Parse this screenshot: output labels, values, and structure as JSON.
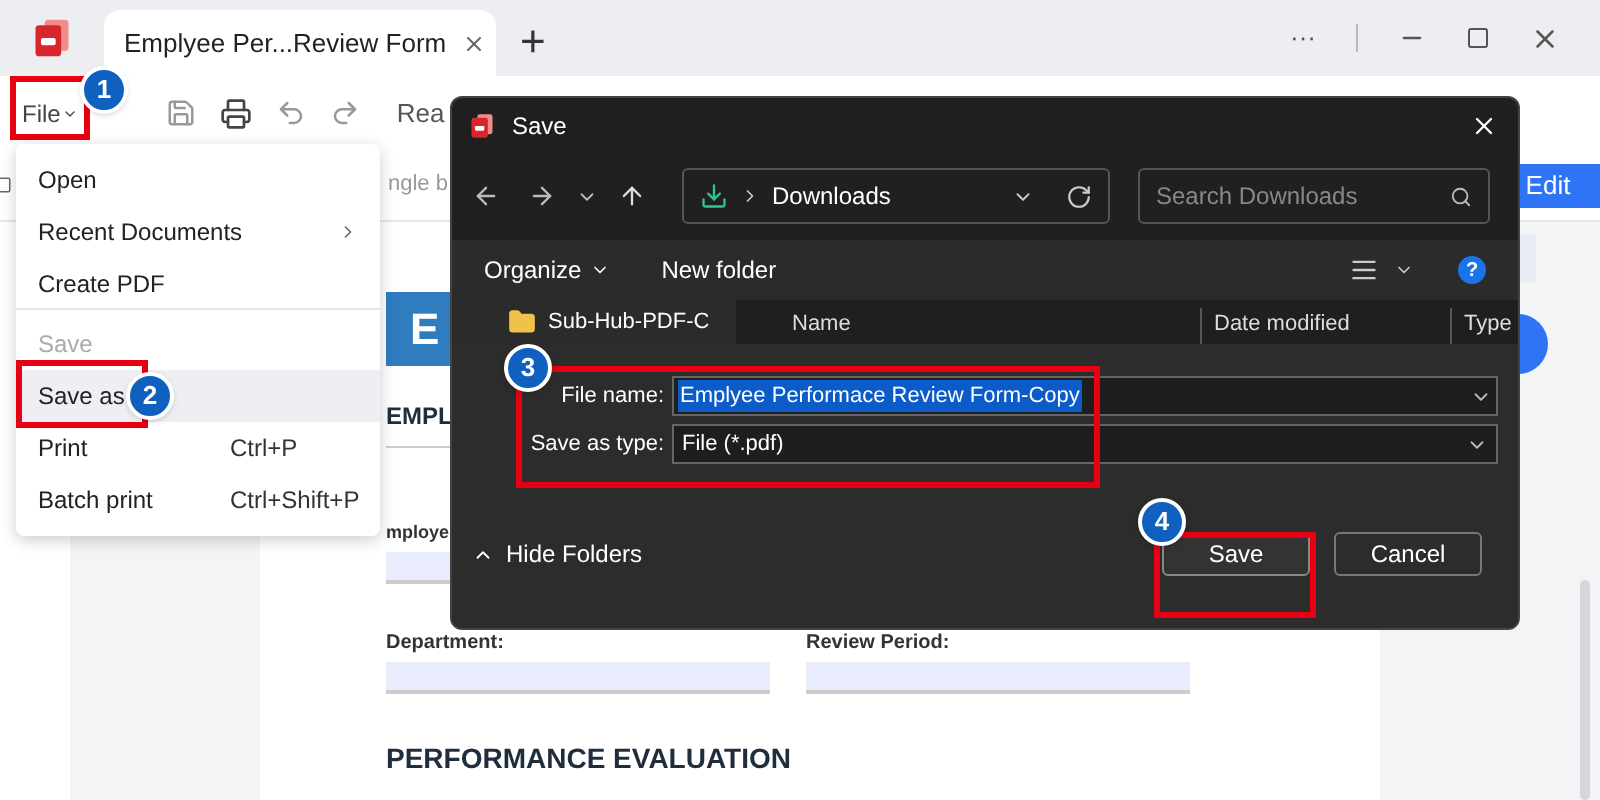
{
  "title_bar": {
    "tab_title": "Emplyee Per...Review Form",
    "new_tab": "+",
    "more": "···"
  },
  "toolbar": {
    "file_menu": "File",
    "read_tab": "Rea",
    "edit_button": "Edit",
    "hint_fragment": "ngle b"
  },
  "file_menu": {
    "items": [
      {
        "label": "Open",
        "submenu": false,
        "disabled": false,
        "selected": false
      },
      {
        "label": "Recent Documents",
        "submenu": true,
        "disabled": false,
        "selected": false
      },
      {
        "label": "Create PDF",
        "submenu": false,
        "disabled": false,
        "selected": false,
        "divider_after": true
      },
      {
        "label": "Save",
        "submenu": false,
        "disabled": true,
        "selected": false
      },
      {
        "label": "Save as",
        "submenu": false,
        "disabled": false,
        "selected": true
      },
      {
        "label": "Print",
        "shortcut": "Ctrl+P",
        "submenu": false,
        "disabled": false,
        "selected": false
      },
      {
        "label": "Batch print",
        "shortcut": "Ctrl+Shift+P",
        "submenu": false,
        "disabled": false,
        "selected": false
      }
    ]
  },
  "document": {
    "header_letter": "E",
    "section_1": "EMPL",
    "fields": [
      {
        "label": "mploye"
      },
      {
        "label": "Department:"
      },
      {
        "label": "Review Period:"
      }
    ],
    "section_2": "PERFORMANCE EVALUATION"
  },
  "save_dialog": {
    "title": "Save",
    "address": "Downloads",
    "search_placeholder": "Search Downloads",
    "organize": "Organize",
    "new_folder": "New folder",
    "help": "?",
    "folders": [
      {
        "name": "Sub-Hub-PDF-C"
      }
    ],
    "columns": [
      "Name",
      "Date modified",
      "Type"
    ],
    "file_name_label": "File name:",
    "file_name": "Emplyee Performace Review Form-Copy",
    "type_label": "Save as type:",
    "type_value": "File (*.pdf)",
    "hide_folders": "Hide Folders",
    "save": "Save",
    "cancel": "Cancel"
  },
  "callouts": [
    {
      "number": "1"
    },
    {
      "number": "2"
    },
    {
      "number": "3"
    },
    {
      "number": "4"
    }
  ]
}
